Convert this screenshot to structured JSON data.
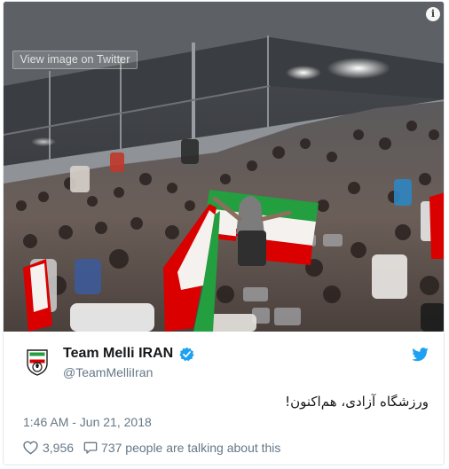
{
  "photo": {
    "view_label": "View image on Twitter",
    "info_icon": "info-icon"
  },
  "author": {
    "name": "Team Melli IRAN",
    "handle": "@TeamMelliIran",
    "verified": true,
    "avatar_icon": "team-melli-crest-icon"
  },
  "tweet": {
    "text": "ورزشگاه آزادی، هم‌اکنون!",
    "timestamp": "1:46 AM - Jun 21, 2018"
  },
  "actions": {
    "like_count": "3,956",
    "talking": "737 people are talking about this"
  },
  "colors": {
    "twitter_blue": "#1da1f2",
    "muted_text": "#657786",
    "iran_green": "#239f40",
    "iran_red": "#da0000"
  }
}
